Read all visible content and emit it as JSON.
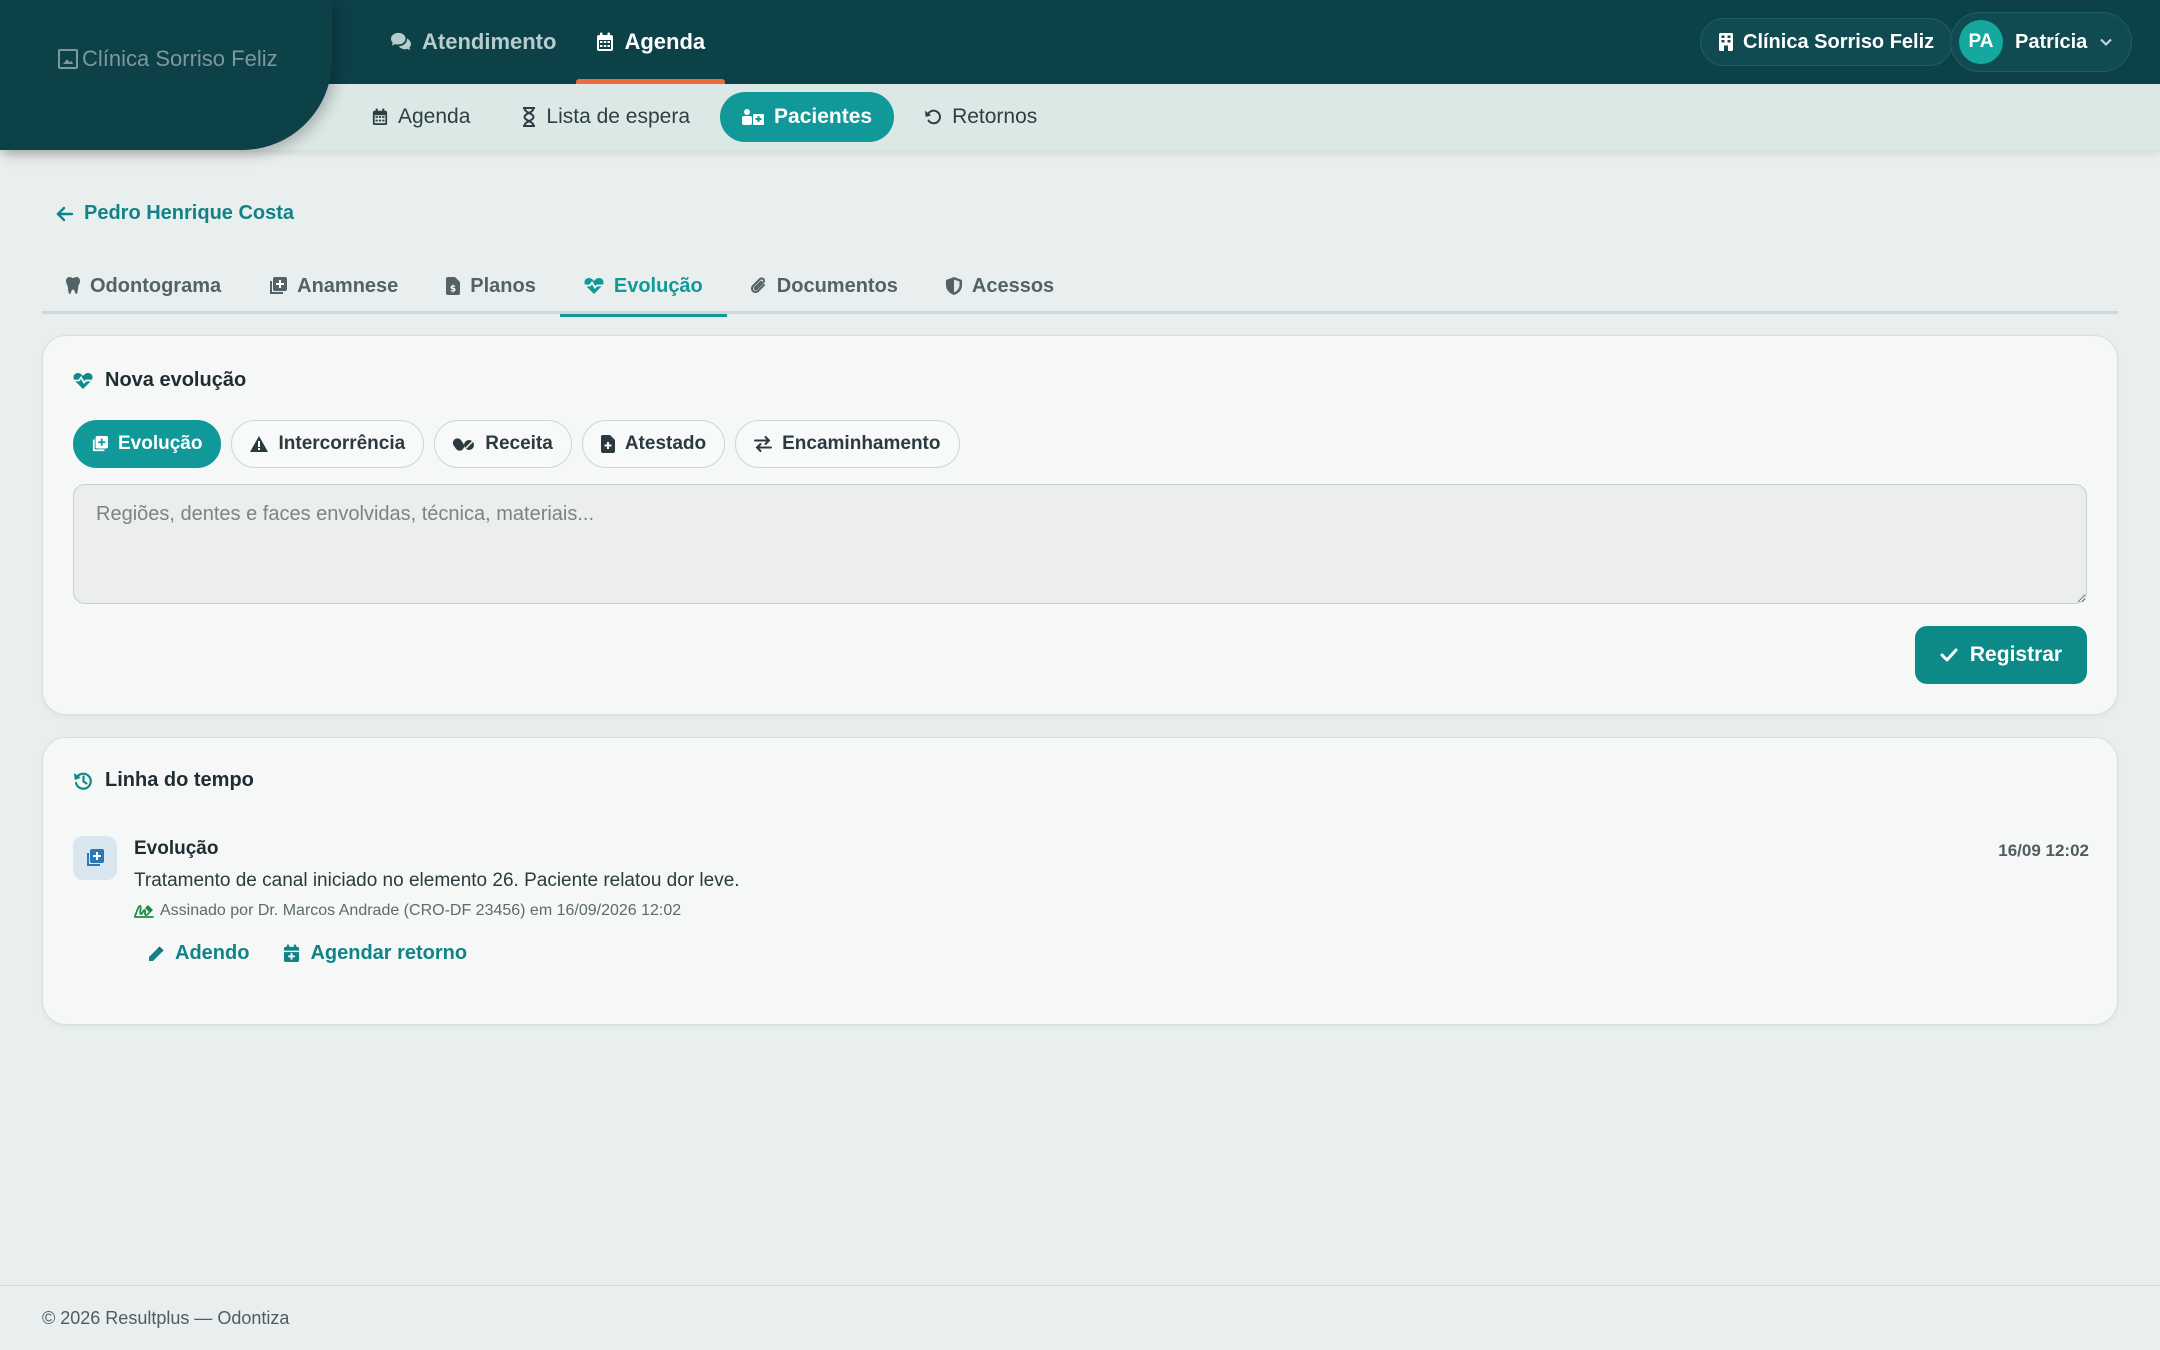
{
  "brand": {
    "logo_alt": "Clínica Sorriso Feliz"
  },
  "main_nav": [
    {
      "label": "Atendimento",
      "icon": "comments-icon"
    },
    {
      "label": "Agenda",
      "icon": "calendar-icon"
    }
  ],
  "sub_nav": [
    {
      "label": "Agenda",
      "icon": "calendar-icon"
    },
    {
      "label": "Lista de espera",
      "icon": "hourglass-icon"
    },
    {
      "label": "Pacientes",
      "icon": "patients-icon"
    },
    {
      "label": "Retornos",
      "icon": "undo-icon"
    }
  ],
  "clinic": {
    "name": "Clínica Sorriso Feliz"
  },
  "user": {
    "initials": "PA",
    "name": "Patrícia"
  },
  "patient": {
    "back_label": "Pedro Henrique Costa"
  },
  "tabs": [
    {
      "label": "Odontograma",
      "icon": "tooth-icon"
    },
    {
      "label": "Anamnese",
      "icon": "notes-medical-icon"
    },
    {
      "label": "Planos",
      "icon": "file-invoice-icon"
    },
    {
      "label": "Evolução",
      "icon": "heart-pulse-icon"
    },
    {
      "label": "Documentos",
      "icon": "paperclip-icon"
    },
    {
      "label": "Acessos",
      "icon": "shield-icon"
    }
  ],
  "new_evolution": {
    "title": "Nova evolução",
    "types": [
      {
        "label": "Evolução",
        "icon": "notes-medical-icon"
      },
      {
        "label": "Intercorrência",
        "icon": "warning-icon"
      },
      {
        "label": "Receita",
        "icon": "pills-icon"
      },
      {
        "label": "Atestado",
        "icon": "file-medical-icon"
      },
      {
        "label": "Encaminhamento",
        "icon": "swap-icon"
      }
    ],
    "placeholder": "Regiões, dentes e faces envolvidas, técnica, materiais...",
    "submit_label": "Registrar"
  },
  "timeline": {
    "title": "Linha do tempo",
    "entries": [
      {
        "type": "Evolução",
        "time": "16/09 12:02",
        "text": "Tratamento de canal iniciado no elemento 26. Paciente relatou dor leve.",
        "signature": "Assinado por Dr. Marcos Andrade (CRO-DF 23456) em 16/09/2026 12:02",
        "actions": [
          "Adendo",
          "Agendar retorno"
        ]
      }
    ]
  },
  "footer": {
    "text": "© 2026 Resultplus — Odontiza"
  },
  "colors": {
    "primary": "#11999a",
    "header": "#0c4148",
    "accent": "#ef6a3a"
  }
}
